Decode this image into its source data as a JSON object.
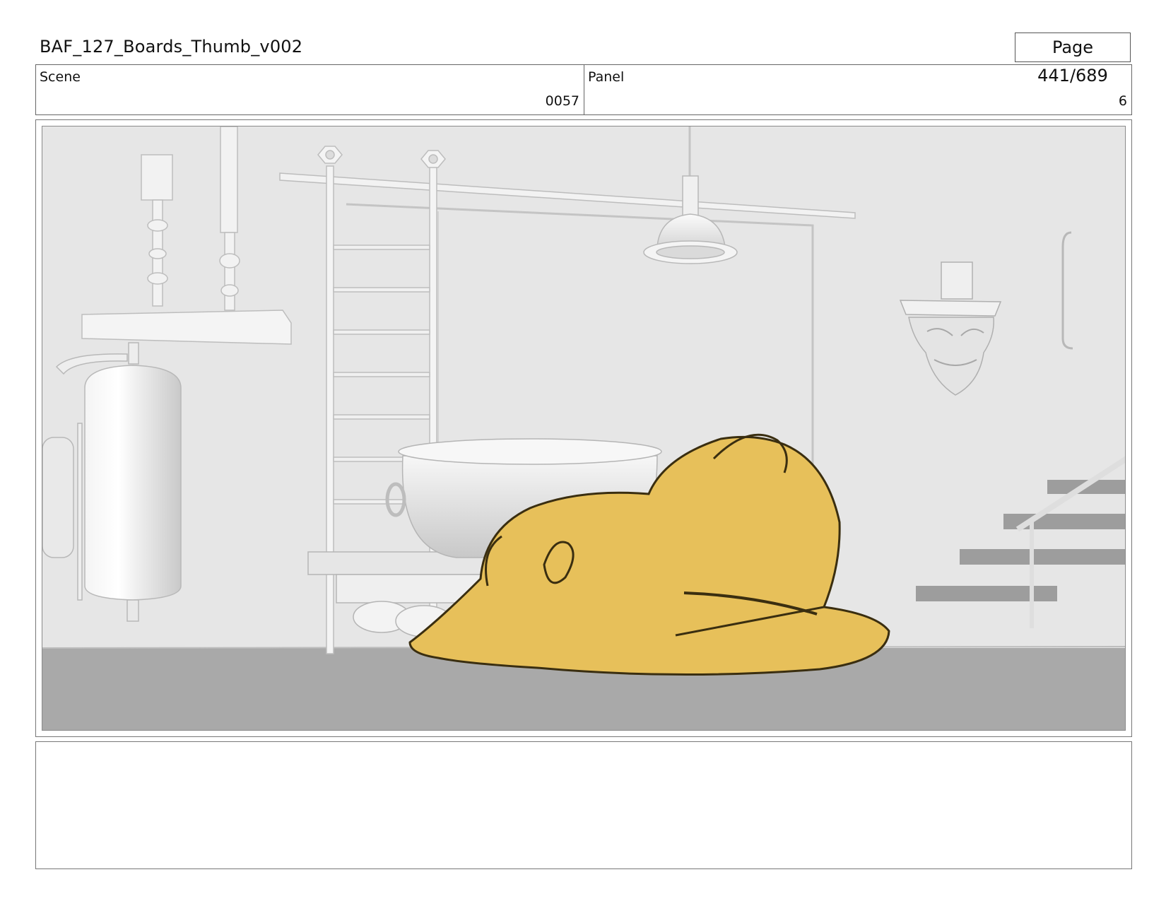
{
  "document": {
    "title": "BAF_127_Boards_Thumb_v002",
    "page_label": "Page 441/689"
  },
  "scene": {
    "label": "Scene",
    "value": "0057"
  },
  "panel": {
    "label": "Panel",
    "value": "6"
  },
  "notes": {
    "text": ""
  },
  "colors": {
    "character_fill": "#e7c05a",
    "character_line": "#3a2e10",
    "background_wall": "#e6e6e6",
    "floor": "#a9a9a9"
  }
}
